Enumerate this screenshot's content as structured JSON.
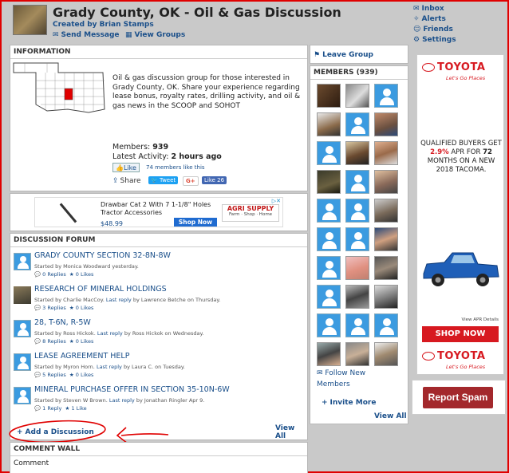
{
  "group": {
    "title": "Grady County, OK - Oil & Gas Discussion",
    "created_by": "Created by Brian Stamps",
    "send_message": "Send Message",
    "view_groups": "View Groups"
  },
  "top_nav": {
    "inbox": "Inbox",
    "alerts": "Alerts",
    "friends": "Friends",
    "settings": "Settings"
  },
  "information": {
    "header": "INFORMATION",
    "description": "Oil & gas discussion group for those interested in Grady County, OK. Share your experience regarding lease bonus, royalty rates, drilling activity, and oil & gas news in the SCOOP and SOHOT",
    "members_label": "Members:",
    "members_value": "939",
    "activity_label": "Latest Activity:",
    "activity_value": "2 hours ago",
    "like_label": "Like",
    "like_count_text": "74 members like this",
    "share_label": "Share",
    "tweet_label": "Tweet",
    "gplus_label": "G+",
    "fb_like_label": "Like 26"
  },
  "ad_banner": {
    "product": "Drawbar Cat 2 With 7 1-1/8\" Holes Tractor Accessories",
    "price": "$48.99",
    "shop_now": "Shop Now",
    "brand": "AGRI SUPPLY",
    "brand_sub": "Farm · Shop · Home"
  },
  "forum": {
    "header": "DISCUSSION FORUM",
    "threads": [
      {
        "title": "GRADY COUNTY SECTION 32-8N-8W",
        "started": "Started by Monica Woodward yesterday.",
        "last_reply_label": "",
        "last_reply": "",
        "replies": "0 Replies",
        "likes": "0 Likes"
      },
      {
        "title": "RESEARCH OF MINERAL HOLDINGS",
        "started": "Started by Charlie MacCoy.",
        "last_reply_label": "Last reply",
        "last_reply": "by Lawrence Betche on Thursday.",
        "replies": "3 Replies",
        "likes": "0 Likes"
      },
      {
        "title": "28, T-6N, R-5W",
        "started": "Started by Ross Hickok.",
        "last_reply_label": "Last reply",
        "last_reply": "by Ross Hickok on Wednesday.",
        "replies": "8 Replies",
        "likes": "0 Likes"
      },
      {
        "title": "LEASE AGREEMENT HELP",
        "started": "Started by Myron Horn.",
        "last_reply_label": "Last reply",
        "last_reply": "by Laura C. on Tuesday.",
        "replies": "5 Replies",
        "likes": "0 Likes"
      },
      {
        "title": "MINERAL PURCHASE OFFER IN SECTION 35-10N-6W",
        "started": "Started by Steven W Brown.",
        "last_reply_label": "Last reply",
        "last_reply": "by Jonathan Ringler Apr 9.",
        "replies": "1 Reply",
        "likes": "1 Like"
      }
    ],
    "add_discussion": "Add a Discussion",
    "view_all": "View All"
  },
  "comment_wall": {
    "header": "COMMENT WALL",
    "comment_label": "Comment"
  },
  "members_panel": {
    "leave_group": "Leave Group",
    "header": "MEMBERS (939)",
    "follow_new": "Follow New Members",
    "invite_more": "Invite More",
    "view_all": "View All"
  },
  "toyota_ad": {
    "brand": "TOYOTA",
    "tagline": "Let's Go Places",
    "headline_1": "QUALIFIED BUYERS GET",
    "apr": "2.9%",
    "headline_2": "APR FOR",
    "months": "72",
    "headline_3": "MONTHS ON A NEW 2018 TACOMA.",
    "disclaimer": "View APR Details",
    "shop_now": "SHOP NOW"
  },
  "report_spam": "Report Spam",
  "colors": {
    "link": "#1a4f8a",
    "avatar_blue": "#3b9be0",
    "toyota_red": "#d71920",
    "annotation_red": "#e00000",
    "spam_button": "#a3282c"
  }
}
